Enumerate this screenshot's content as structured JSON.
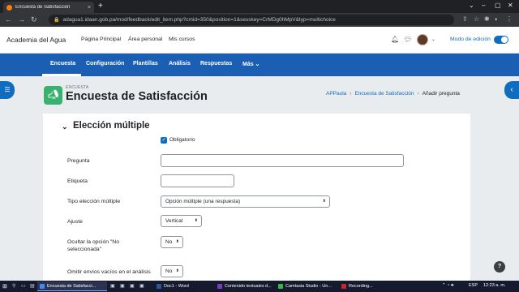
{
  "browser": {
    "tab_title": "Encuesta de Satisfacción",
    "tab_close": "×",
    "new_tab": "+",
    "url": "adagua1.idaan.gob.pa/mod/feedback/edit_item.php?cmid=350&position=1&sesskey=CrMDg0hMpV&typ=multichoice"
  },
  "navbar": {
    "site_name": "Academia del Agua",
    "links": [
      "Página Principal",
      "Área personal",
      "Mis cursos"
    ],
    "edit_mode_label": "Modo de edición",
    "edit_mode_on": true
  },
  "secondary_nav": {
    "items": [
      "Encuesta",
      "Configuración",
      "Plantillas",
      "Análisis",
      "Respuestas",
      "Más ⌄"
    ],
    "active": "Encuesta"
  },
  "header": {
    "module_type": "ENCUESTA",
    "title": "Encuesta de Satisfacción",
    "breadcrumb": [
      "APPaula",
      "Encuesta de Satisfacción",
      "Añadir pregunta"
    ],
    "breadcrumb_sep": "›"
  },
  "form": {
    "section_title": "Elección múltiple",
    "required_label": "Obligatorio",
    "required_checked": true,
    "fields": {
      "question_label": "Pregunta",
      "question_value": "",
      "tag_label": "Etiqueta",
      "tag_value": "",
      "type_label": "Tipo elección múltiple",
      "type_value": "Opción múltiple (una respuesta)",
      "adjust_label": "Ajuste",
      "adjust_value": "Vertical",
      "hide_label": "Ocultar la opción \"No seleccionada\"",
      "hide_value": "No",
      "omit_label": "Omitir envíos vacíos en el análisis",
      "omit_value": "No"
    }
  },
  "help_label": "?",
  "taskbar": {
    "apps": [
      {
        "label": "Encuesta de Satisfacci...",
        "color": "#4285f4"
      },
      {
        "label": "Doc1 - Word",
        "color": "#2b579a"
      },
      {
        "label": "Contenido textuales d...",
        "color": "#7a3fb8"
      },
      {
        "label": "Camtasia Studio - Un...",
        "color": "#3bb54a"
      },
      {
        "label": "Recording...",
        "color": "#c62828"
      }
    ],
    "language": "ESP",
    "time": "12:23 a. m."
  }
}
